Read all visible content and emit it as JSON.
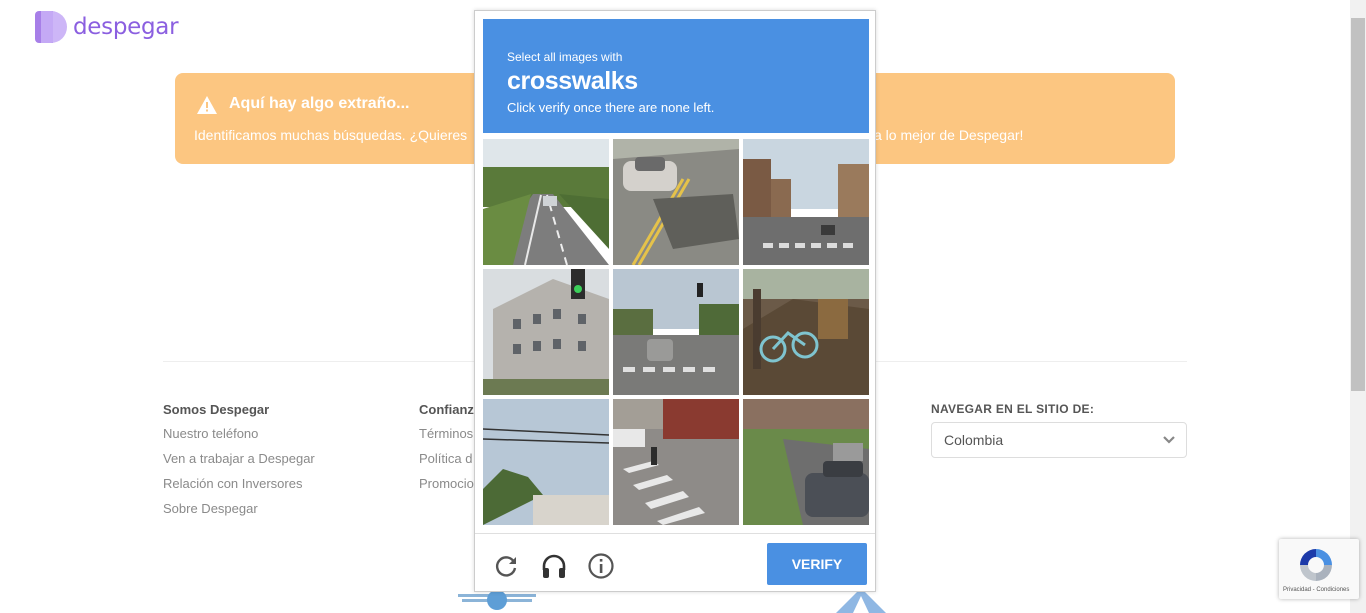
{
  "site": {
    "brand": "despegar"
  },
  "alert": {
    "title": "Aquí hay algo extraño...",
    "message_left": "Identificamos muchas búsquedas. ¿Quieres",
    "message_right": "a lo mejor de Despegar!"
  },
  "footer": {
    "col1": {
      "title": "Somos Despegar",
      "links": [
        "Nuestro teléfono",
        "Ven a trabajar a Despegar",
        "Relación con Inversores",
        "Sobre Despegar"
      ]
    },
    "col2": {
      "title": "Confianz",
      "links": [
        "Términos",
        "Política d",
        "Promocio"
      ]
    },
    "site_nav": {
      "label": "NAVEGAR EN EL SITIO DE:",
      "selected": "Colombia"
    }
  },
  "captcha": {
    "instruction": "Select all images with",
    "target": "crosswalks",
    "note": "Click verify once there are none left.",
    "verify_label": "VERIFY",
    "tiles": [
      {
        "scene": "highway-car"
      },
      {
        "scene": "car-on-road"
      },
      {
        "scene": "street-crosswalk"
      },
      {
        "scene": "building-traffic-light"
      },
      {
        "scene": "intersection-crosswalk"
      },
      {
        "scene": "bicycle-sidewalk"
      },
      {
        "scene": "power-lines-trees"
      },
      {
        "scene": "pedestrian-crosswalk"
      },
      {
        "scene": "parked-cars"
      }
    ]
  },
  "recaptcha_badge": {
    "text": "Privacidad - Condiciones"
  },
  "colors": {
    "brand": "#8b5fe0",
    "alert": "#fcc681",
    "captcha_blue": "#4a90e2"
  }
}
